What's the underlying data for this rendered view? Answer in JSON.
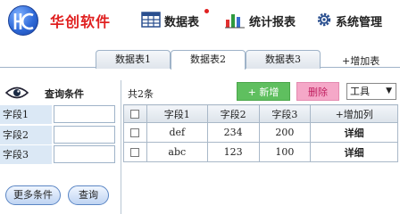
{
  "brand": {
    "name": "华创软件"
  },
  "nav": [
    {
      "label": "数据表",
      "icon": "table-icon",
      "has_badge": true
    },
    {
      "label": "统计报表",
      "icon": "bar-chart-icon"
    },
    {
      "label": "系统管理",
      "icon": "gear-icon"
    }
  ],
  "tabs": [
    {
      "label": "数据表1",
      "active": false
    },
    {
      "label": "数据表2",
      "active": true
    },
    {
      "label": "数据表3",
      "active": false
    }
  ],
  "add_table_label": "+增加表",
  "filter": {
    "title": "查询条件",
    "fields": [
      {
        "label": "字段1",
        "value": ""
      },
      {
        "label": "字段2",
        "value": ""
      },
      {
        "label": "字段3",
        "value": ""
      }
    ],
    "more_button": "更多条件",
    "query_button": "查询"
  },
  "toolbar": {
    "count": "共2条",
    "add_button": "+ 新增",
    "delete_button": "删除",
    "tools_select": "工具"
  },
  "table": {
    "columns": [
      "",
      "字段1",
      "字段2",
      "字段3",
      "+增加列"
    ],
    "rows": [
      {
        "f1": "def",
        "f2": "234",
        "f3": "200",
        "action": "详细"
      },
      {
        "f1": "abc",
        "f2": "123",
        "f3": "100",
        "action": "详细"
      }
    ]
  },
  "colors": {
    "brand_red": "#e02020",
    "add_green": "#5fbf5f",
    "delete_pink": "#f5a8c8",
    "label_bg": "#dbe8f5"
  }
}
